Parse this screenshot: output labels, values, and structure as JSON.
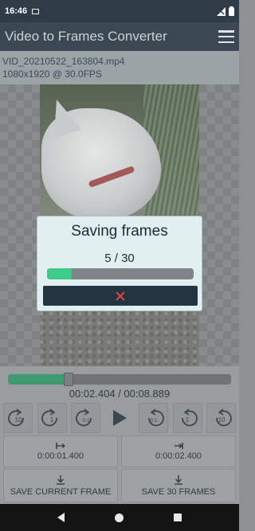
{
  "status": {
    "time": "16:46"
  },
  "app": {
    "title": "Video to Frames Converter"
  },
  "video": {
    "filename": "VID_20210522_163804.mp4",
    "details": "1080x1920 @ 30.0FPS"
  },
  "dialog": {
    "title": "Saving frames",
    "count": "5 / 30",
    "progress_fraction": 0.1667,
    "progress_color": "#3fcc8a",
    "cancel_color": "#e14a4a"
  },
  "playback": {
    "time_readout": "00:02.404 / 00:08.889",
    "position_fraction": 0.27
  },
  "transport": [
    {
      "label": "10",
      "dir": "back"
    },
    {
      "label": "1",
      "dir": "back"
    },
    {
      "label": "0.1",
      "dir": "back"
    },
    {
      "label": "",
      "dir": "play"
    },
    {
      "label": "0.1",
      "dir": "fwd"
    },
    {
      "label": "1",
      "dir": "fwd"
    },
    {
      "label": "10",
      "dir": "fwd"
    }
  ],
  "marks": {
    "start": "0:00:01.400",
    "end": "0:00:02.400"
  },
  "actions": {
    "save_current": "SAVE CURRENT FRAME",
    "save_all": "SAVE 30 FRAMES"
  }
}
